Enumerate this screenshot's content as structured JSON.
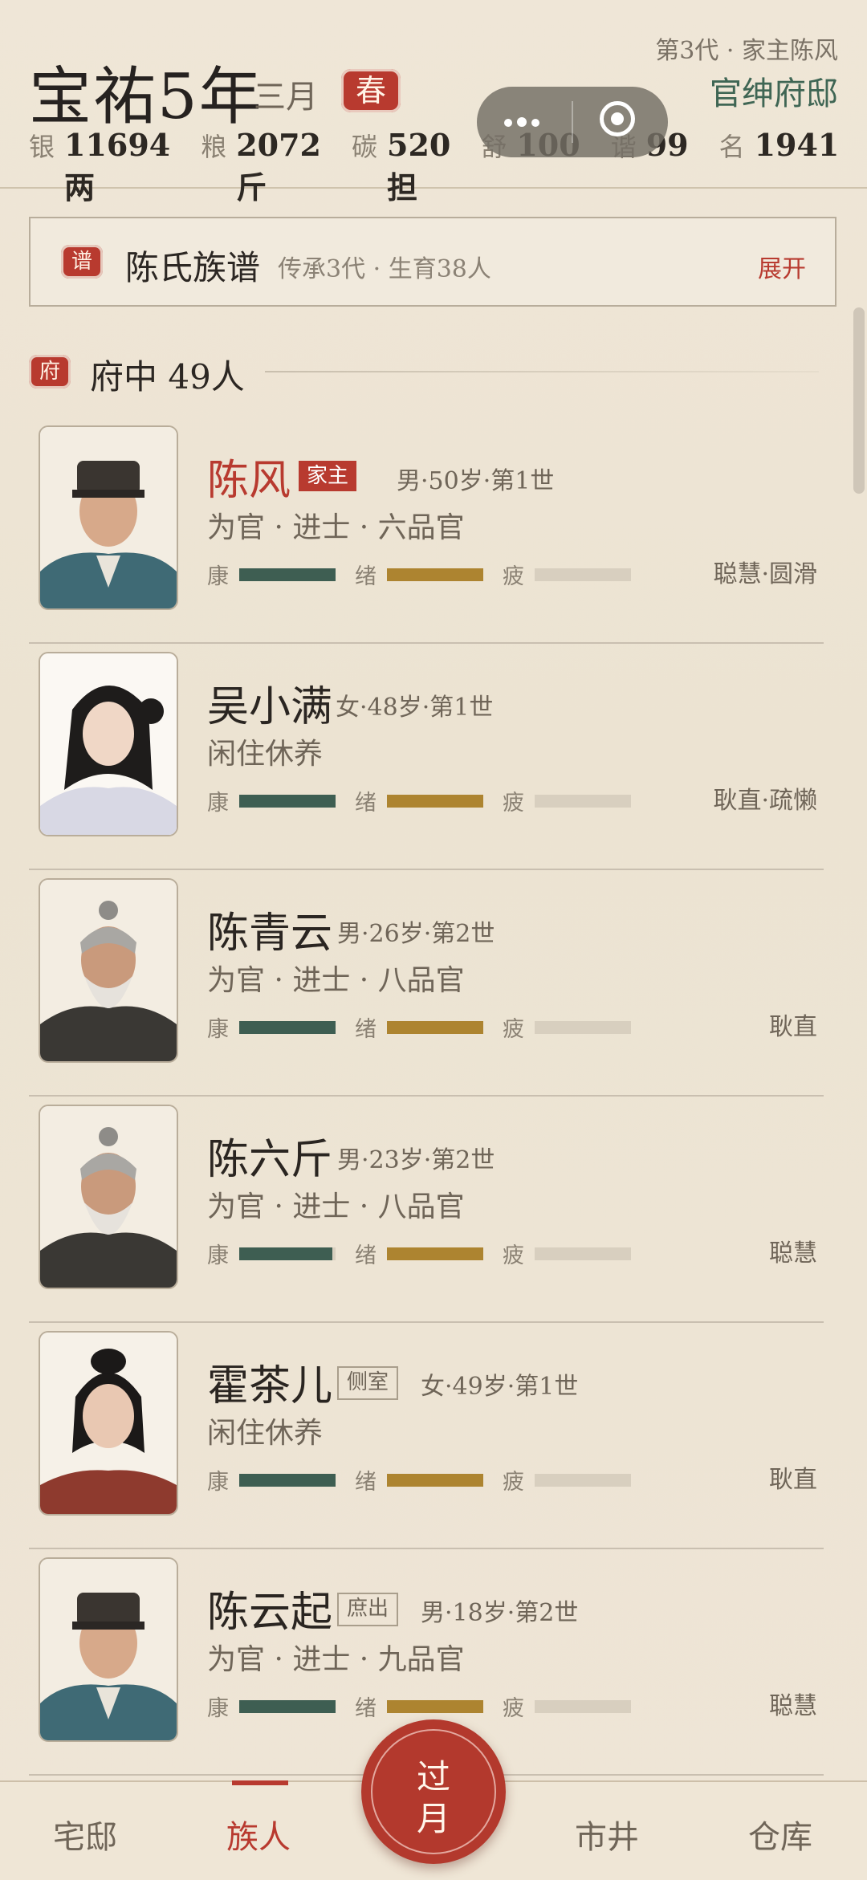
{
  "header": {
    "era": "宝祐5年",
    "month": "三月",
    "season": "春",
    "generation_info": "第3代 · 家主陈风",
    "estate": "官绅府邸",
    "stats": [
      {
        "key": "银",
        "value": "11694两"
      },
      {
        "key": "粮",
        "value": "2072斤"
      },
      {
        "key": "碳",
        "value": "520担"
      },
      {
        "key": "舒",
        "value": "100"
      },
      {
        "key": "谐",
        "value": "99"
      },
      {
        "key": "名",
        "value": "1941"
      }
    ]
  },
  "genealogy": {
    "seal": "谱",
    "title": "陈氏族谱",
    "subtitle": "传承3代 · 生育38人",
    "expand": "展开"
  },
  "section": {
    "seal": "府",
    "title": "府中 49人"
  },
  "members": [
    {
      "name": "陈风",
      "tag": "家主",
      "info": "男·50岁·第1世",
      "role": "为官 · 进士 · 六品官",
      "health": 1.0,
      "mood": 1.0,
      "fatigue": 0.0,
      "traits": "聪慧·圆滑"
    },
    {
      "name": "吴小满",
      "tag": "",
      "info": "女·48岁·第1世",
      "role": "闲住休养",
      "health": 1.0,
      "mood": 1.0,
      "fatigue": 0.0,
      "traits": "耿直·疏懒"
    },
    {
      "name": "陈青云",
      "tag": "",
      "info": "男·26岁·第2世",
      "role": "为官 · 进士 · 八品官",
      "health": 1.0,
      "mood": 1.0,
      "fatigue": 0.0,
      "traits": "耿直"
    },
    {
      "name": "陈六斤",
      "tag": "",
      "info": "男·23岁·第2世",
      "role": "为官 · 进士 · 八品官",
      "health": 0.97,
      "mood": 1.0,
      "fatigue": 0.0,
      "traits": "聪慧"
    },
    {
      "name": "霍茶儿",
      "tag": "侧室",
      "info": "女·49岁·第1世",
      "role": "闲住休养",
      "health": 1.0,
      "mood": 1.0,
      "fatigue": 0.0,
      "traits": "耿直"
    },
    {
      "name": "陈云起",
      "tag": "庶出",
      "info": "男·18岁·第2世",
      "role": "为官 · 进士 · 九品官",
      "health": 1.0,
      "mood": 1.0,
      "fatigue": 0.0,
      "traits": "聪慧"
    }
  ],
  "bar_labels": {
    "health": "康",
    "mood": "绪",
    "fatigue": "疲"
  },
  "tabs": [
    {
      "label": "宅邸"
    },
    {
      "label": "族人"
    },
    {
      "label": "市井"
    },
    {
      "label": "仓库"
    }
  ],
  "next_button": {
    "line1": "过",
    "line2": "月"
  },
  "colors": {
    "accent_red": "#b83a2f",
    "estate_green": "#3f6654",
    "health_bar": "#3e5e52",
    "mood_bar": "#ad8430"
  }
}
